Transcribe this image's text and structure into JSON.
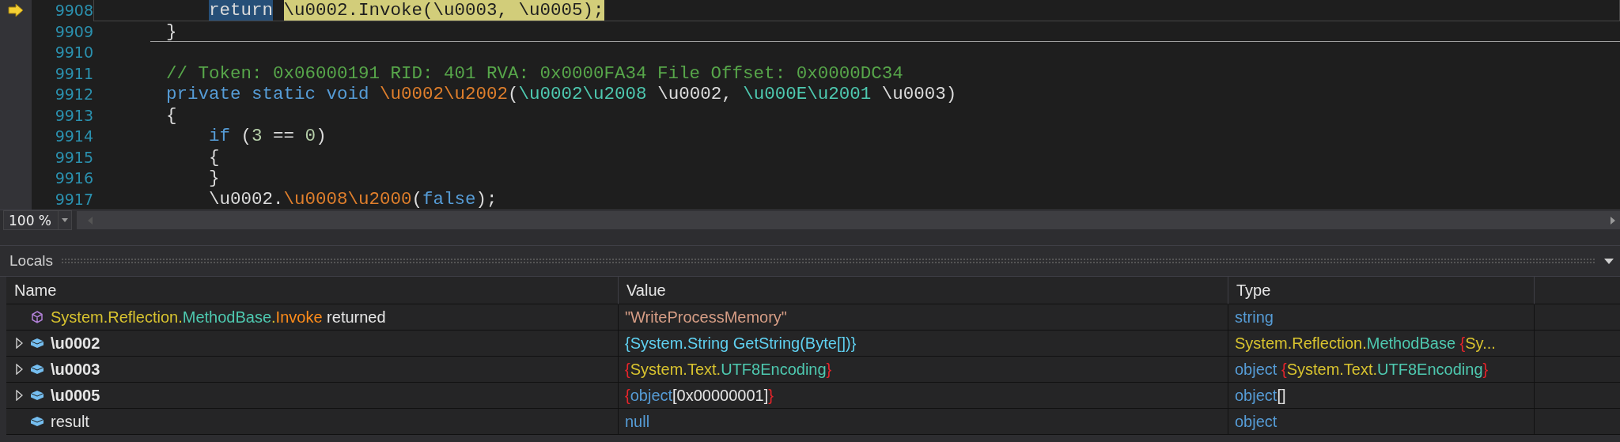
{
  "editor": {
    "lines": [
      {
        "number": "9908",
        "current": true,
        "separator_below": false,
        "segments": [
          {
            "kind": "selected",
            "text": "    return"
          },
          {
            "kind": "highlight",
            "text": " \\u0002.Invoke(\\u0003, \\u0005);"
          }
        ]
      },
      {
        "number": "9909",
        "current": false,
        "separator_below": true,
        "segments": [
          {
            "kind": "plain",
            "text": "}"
          }
        ]
      },
      {
        "number": "9910",
        "current": false,
        "separator_below": false
      },
      {
        "number": "9911",
        "current": false,
        "separator_below": false,
        "segments": [
          {
            "kind": "comment",
            "text": "// Token: 0x06000191 RID: 401 RVA: 0x0000FA34 File Offset: 0x0000DC34"
          }
        ]
      },
      {
        "number": "9912",
        "current": false,
        "separator_below": false,
        "segments": [
          {
            "kind": "keyword",
            "text": "private static void "
          },
          {
            "kind": "method",
            "text": "\\u0002\\u2002"
          },
          {
            "kind": "plain",
            "text": "("
          },
          {
            "kind": "type",
            "text": "\\u0002\\u2008"
          },
          {
            "kind": "plain",
            "text": " \\u0002, "
          },
          {
            "kind": "type",
            "text": "\\u000E\\u2001"
          },
          {
            "kind": "plain",
            "text": " \\u0003)"
          }
        ]
      },
      {
        "number": "9913",
        "current": false,
        "separator_below": false,
        "segments": [
          {
            "kind": "plain",
            "text": "{"
          }
        ]
      },
      {
        "number": "9914",
        "current": false,
        "separator_below": false,
        "segments": [
          {
            "kind": "keyword",
            "text": "    if"
          },
          {
            "kind": "plain",
            "text": " ("
          },
          {
            "kind": "number",
            "text": "3"
          },
          {
            "kind": "plain",
            "text": " == "
          },
          {
            "kind": "number",
            "text": "0"
          },
          {
            "kind": "plain",
            "text": ")"
          }
        ]
      },
      {
        "number": "9915",
        "current": false,
        "separator_below": false,
        "segments": [
          {
            "kind": "plain",
            "text": "    {"
          }
        ]
      },
      {
        "number": "9916",
        "current": false,
        "separator_below": false,
        "segments": [
          {
            "kind": "plain",
            "text": "    }"
          }
        ]
      },
      {
        "number": "9917",
        "current": false,
        "separator_below": false,
        "segments": [
          {
            "kind": "plain",
            "text": "    \\u0002."
          },
          {
            "kind": "method",
            "text": "\\u0008\\u2000"
          },
          {
            "kind": "plain",
            "text": "("
          },
          {
            "kind": "keyword",
            "text": "false"
          },
          {
            "kind": "plain",
            "text": ");"
          }
        ]
      }
    ]
  },
  "zoom": {
    "value": "100 %"
  },
  "locals": {
    "title": "Locals",
    "columns": [
      "Name",
      "Value",
      "Type"
    ],
    "rows": [
      {
        "kind": "return_value",
        "expandable": false,
        "bold": false,
        "name": [
          {
            "kind": "ns",
            "text": "System.Reflection."
          },
          {
            "kind": "class",
            "text": "MethodBase"
          },
          {
            "kind": "ns",
            "text": "."
          },
          {
            "kind": "method",
            "text": "Invoke"
          },
          {
            "kind": "plain",
            "text": " returned"
          }
        ],
        "value": [
          {
            "kind": "string",
            "text": "\"WriteProcessMemory\""
          }
        ],
        "type": [
          {
            "kind": "keyword",
            "text": "string"
          }
        ]
      },
      {
        "kind": "local",
        "expandable": true,
        "bold": true,
        "name": [
          {
            "kind": "plain",
            "text": "\\u0002"
          }
        ],
        "value": [
          {
            "kind": "delegate",
            "text": "{System.String GetString(Byte[])}"
          }
        ],
        "type": [
          {
            "kind": "ns",
            "text": "System.Reflection."
          },
          {
            "kind": "class",
            "text": "MethodBase"
          },
          {
            "kind": "brace",
            "text": " {"
          },
          {
            "kind": "ns",
            "text": "Sy..."
          }
        ]
      },
      {
        "kind": "local",
        "expandable": true,
        "bold": true,
        "name": [
          {
            "kind": "plain",
            "text": "\\u0003"
          }
        ],
        "value": [
          {
            "kind": "brace",
            "text": "{"
          },
          {
            "kind": "ns",
            "text": "System.Text."
          },
          {
            "kind": "class",
            "text": "UTF8Encoding"
          },
          {
            "kind": "brace",
            "text": "}"
          }
        ],
        "type": [
          {
            "kind": "keyword",
            "text": "object"
          },
          {
            "kind": "brace",
            "text": " {"
          },
          {
            "kind": "ns",
            "text": "System.Text."
          },
          {
            "kind": "class",
            "text": "UTF8Encoding"
          },
          {
            "kind": "brace",
            "text": "}"
          }
        ]
      },
      {
        "kind": "local",
        "expandable": true,
        "bold": true,
        "name": [
          {
            "kind": "plain",
            "text": "\\u0005"
          }
        ],
        "value": [
          {
            "kind": "brace",
            "text": "{"
          },
          {
            "kind": "keyword",
            "text": "object"
          },
          {
            "kind": "plain",
            "text": "[0x00000001]"
          },
          {
            "kind": "brace",
            "text": "}"
          }
        ],
        "type": [
          {
            "kind": "keyword",
            "text": "object"
          },
          {
            "kind": "plain",
            "text": "[]"
          }
        ]
      },
      {
        "kind": "local",
        "expandable": false,
        "bold": false,
        "name": [
          {
            "kind": "plain",
            "text": "result"
          }
        ],
        "value": [
          {
            "kind": "keyword",
            "text": "null"
          }
        ],
        "type": [
          {
            "kind": "keyword",
            "text": "object"
          }
        ]
      }
    ]
  }
}
